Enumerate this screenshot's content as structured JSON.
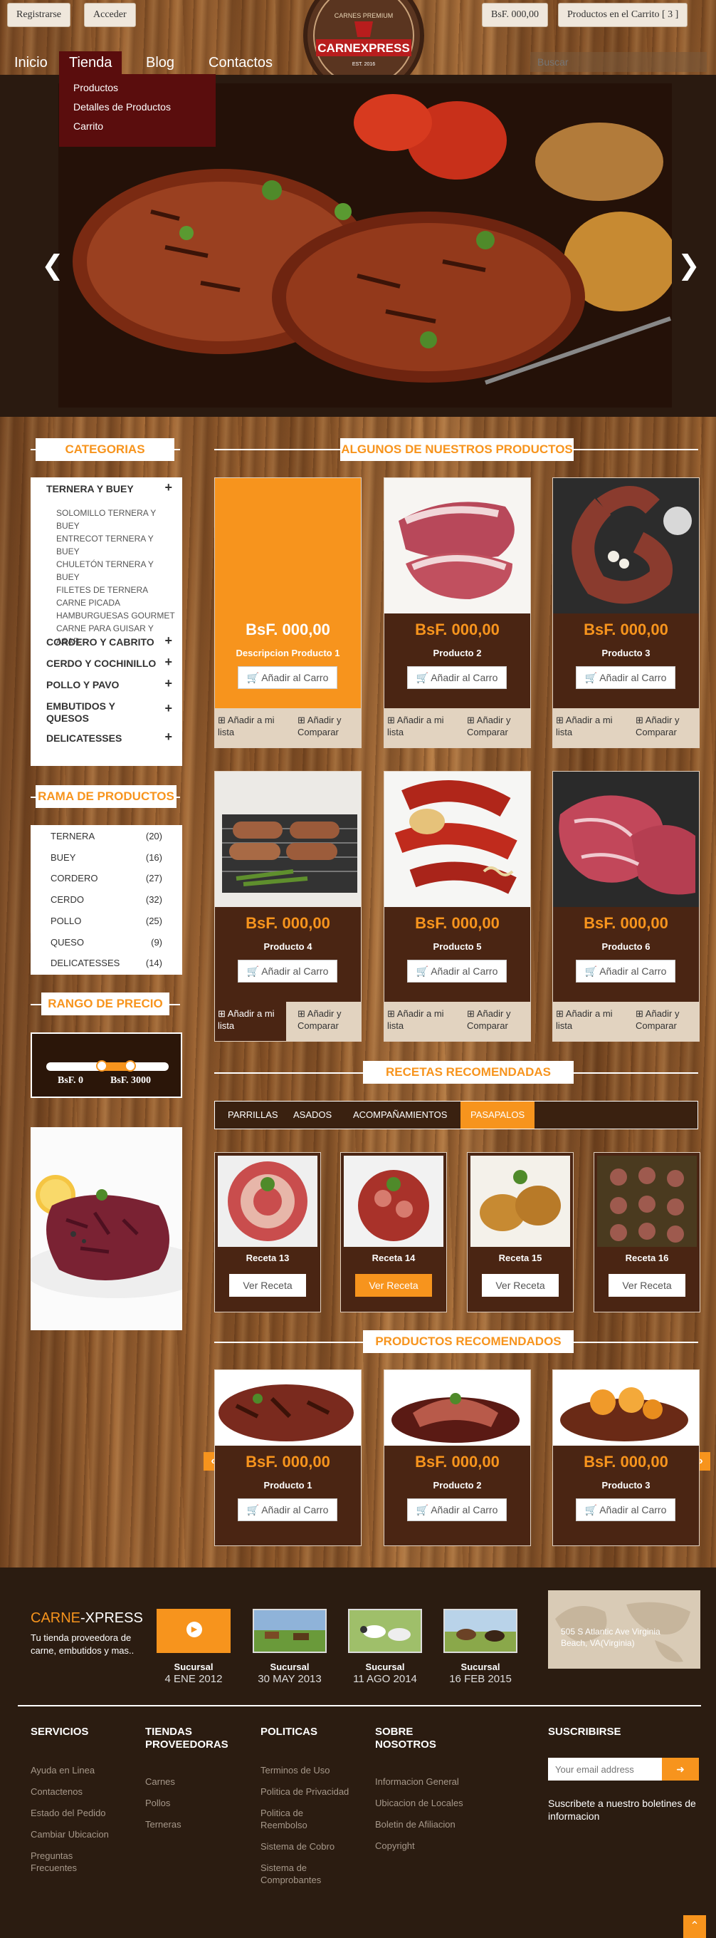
{
  "header": {
    "register_label": "Registrarse",
    "login_label": "Acceder",
    "cart_total": "BsF. 000,00",
    "cart_label": "Productos en el Carrito [ 3 ]",
    "logo_text": "CARNEXPRESS",
    "logo_top": "CARNES PREMIUM",
    "logo_est": "EST. 2016",
    "search_placeholder": "Buscar"
  },
  "nav": {
    "items": [
      {
        "label": "Inicio"
      },
      {
        "label": "Tienda"
      },
      {
        "label": "Blog"
      },
      {
        "label": "Contactos"
      }
    ],
    "dropdown": [
      "Productos",
      "Detalles de Productos",
      "Carrito"
    ]
  },
  "slider": {
    "prev_icon": "chevron-left-icon",
    "next_icon": "chevron-right-icon",
    "active_dot": 2,
    "dot_count": 5
  },
  "sidebar": {
    "categorias_title": "CATEGORIAS",
    "categories": [
      {
        "label": "TERNERA Y BUEY",
        "expanded": true,
        "sub": [
          "SOLOMILLO TERNERA Y BUEY",
          "ENTRECOT TERNERA Y BUEY",
          "CHULETÓN TERNERA Y BUEY",
          "FILETES DE TERNERA",
          "CARNE PICADA",
          "HAMBURGUESAS GOURMET",
          "CARNE PARA GUISAR Y ASAR"
        ]
      },
      {
        "label": "CORDERO Y CABRITO"
      },
      {
        "label": "CERDO Y COCHINILLO"
      },
      {
        "label": "POLLO Y PAVO"
      },
      {
        "label": "EMBUTIDOS Y QUESOS"
      },
      {
        "label": "DELICATESSES"
      }
    ],
    "rama_title": "RAMA DE PRODUCTOS",
    "rama": [
      {
        "label": "TERNERA",
        "count": "(20)"
      },
      {
        "label": "BUEY",
        "count": "(16)"
      },
      {
        "label": "CORDERO",
        "count": "(27)"
      },
      {
        "label": "CERDO",
        "count": "(32)"
      },
      {
        "label": "POLLO",
        "count": "(25)"
      },
      {
        "label": "QUESO",
        "count": "(9)"
      },
      {
        "label": "DELICATESSES",
        "count": "(14)"
      }
    ],
    "precio_title": "RANGO DE PRECIO",
    "price_min": "BsF. 0",
    "price_max": "BsF. 3000"
  },
  "products_title": "ALGUNOS DE NUESTROS PRODUCTOS",
  "products": [
    {
      "price": "BsF. 000,00",
      "name": "Descripcion Producto 1"
    },
    {
      "price": "BsF. 000,00",
      "name": "Producto 2"
    },
    {
      "price": "BsF. 000,00",
      "name": "Producto 3"
    },
    {
      "price": "BsF. 000,00",
      "name": "Producto 4"
    },
    {
      "price": "BsF. 000,00",
      "name": "Producto 5"
    },
    {
      "price": "BsF. 000,00",
      "name": "Producto 6"
    }
  ],
  "add_to_cart": "Añadir al Carro",
  "add_to_list": "Añadir a mi lista",
  "compare": "Añadir y Comparar",
  "recipes_title": "RECETAS RECOMENDADAS",
  "recipe_tabs": [
    "PARRILLAS",
    "ASADOS",
    "ACOMPAÑAMIENTOS",
    "PASAPALOS"
  ],
  "recipes": [
    {
      "name": "Receta 13"
    },
    {
      "name": "Receta 14"
    },
    {
      "name": "Receta 15"
    },
    {
      "name": "Receta 16"
    }
  ],
  "ver_receta": "Ver Receta",
  "recommended_title": "PRODUCTOS RECOMENDADOS",
  "recommended": [
    {
      "price": "BsF. 000,00",
      "name": "Producto 1"
    },
    {
      "price": "BsF. 000,00",
      "name": "Producto 2"
    },
    {
      "price": "BsF. 000,00",
      "name": "Producto 3"
    }
  ],
  "footer": {
    "brand_a": "CARNE",
    "brand_b": "-XPRESS",
    "tagline": "Tu tienda proveedora de carne, embutidos y mas..",
    "branches": [
      {
        "name": "Sucursal",
        "date": "4 ENE 2012"
      },
      {
        "name": "Sucursal",
        "date": "30 MAY 2013"
      },
      {
        "name": "Sucursal",
        "date": "11 AGO 2014"
      },
      {
        "name": "Sucursal",
        "date": "16 FEB 2015"
      }
    ],
    "address": "505 S Atlantic Ave Virginia Beach, VA(Virginia)",
    "columns": [
      {
        "title": "SERVICIOS",
        "links": [
          "Ayuda en Linea",
          "Contactenos",
          "Estado del Pedido",
          "Cambiar Ubicacion",
          "Preguntas Frecuentes"
        ]
      },
      {
        "title": "TIENDAS PROVEEDORAS",
        "links": [
          "Carnes",
          "Pollos",
          "Terneras"
        ]
      },
      {
        "title": "POLITICAS",
        "links": [
          "Terminos de Uso",
          "Politica de Privacidad",
          "Politica de Reembolso",
          "Sistema de Cobro",
          "Sistema de Comprobantes"
        ]
      },
      {
        "title": "SOBRE NOSOTROS",
        "links": [
          "Informacion General",
          "Ubicacion de Locales",
          "Boletin de Afiliacion",
          "Copyright"
        ]
      }
    ],
    "subscribe_title": "SUSCRIBIRSE",
    "email_placeholder": "Your email address",
    "subscribe_note": "Suscribete a nuestro boletines de informacion"
  },
  "colors": {
    "accent": "#f7941d",
    "dark_brown": "#4a2513",
    "nav_red": "#5a0d0d"
  }
}
